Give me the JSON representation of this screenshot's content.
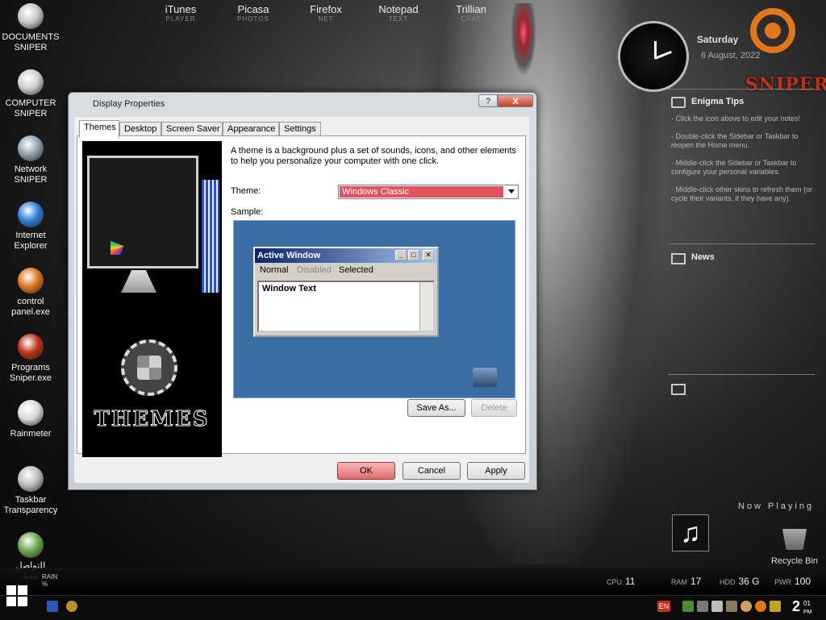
{
  "desktop_icons": [
    {
      "label": "DOCUMENTS\nSNIPER",
      "icon": "atom-icon",
      "color": "#c8c8c8"
    },
    {
      "label": "COMPUTER\nSNIPER",
      "icon": "computer-icon",
      "color": "#cfcfcf"
    },
    {
      "label": "Network\nSNIPER",
      "icon": "network-icon",
      "color": "#8fa3b0"
    },
    {
      "label": "Internet\nExplorer",
      "icon": "ie-icon",
      "color": "#2f7fd8"
    },
    {
      "label": "control\npanel.exe",
      "icon": "ubuntu-icon",
      "color": "#e2761b"
    },
    {
      "label": "Programs\nSniper.exe",
      "icon": "programs-icon",
      "color": "#c0301b"
    },
    {
      "label": "Rainmeter",
      "icon": "rainmeter-icon",
      "color": "#d9d9d9"
    },
    {
      "label": "Taskbar\nTransparency",
      "icon": "taskbar-icon",
      "color": "#bdbdbd"
    },
    {
      "label": "للتواصل\nمعنا",
      "icon": "globe-icon",
      "color": "#6aa84f"
    }
  ],
  "clock": {
    "day": "Saturday",
    "date": "6 August, 2022"
  },
  "brand": {
    "logo_text": "SNIPER"
  },
  "sidebar": {
    "tips_title": "Enigma Tips",
    "tips": [
      "· Click the icon above to edit your notes!",
      "· Double-click the Sidebar or Taskbar to reopen the Home menu.",
      "· Middle-click the Sidebar or Taskbar to configure your personal variables.",
      "· Middle-click other skins to refresh them (or cycle their variants, if they have any)."
    ],
    "news_title": "News",
    "now_playing": "Now Playing",
    "recycle_bin": "Recycle Bin"
  },
  "dialog": {
    "title": "Display Properties",
    "help_btn": "?",
    "close_btn": "X",
    "tabs": [
      "Themes",
      "Desktop",
      "Screen Saver",
      "Appearance",
      "Settings"
    ],
    "active_tab": "Themes",
    "description": "A theme is a background plus a set of sounds, icons, and other elements to help you personalize your computer with one click.",
    "theme_label": "Theme:",
    "theme_value": "Windows Classic",
    "sample_label": "Sample:",
    "art_text": "THEMES",
    "sample_window": {
      "title": "Active Window",
      "menu_normal": "Normal",
      "menu_disabled": "Disabled",
      "menu_selected": "Selected",
      "body_text": "Window Text"
    },
    "buttons": {
      "save_as": "Save As...",
      "delete": "Delete",
      "ok": "OK",
      "cancel": "Cancel",
      "apply": "Apply"
    }
  },
  "dock": {
    "apps": [
      {
        "name": "iTunes",
        "sub": "PLAYER"
      },
      {
        "name": "Picasa",
        "sub": "PHOTOS"
      },
      {
        "name": "Firefox",
        "sub": "NET"
      },
      {
        "name": "Notepad",
        "sub": "TEXT"
      },
      {
        "name": "Trillian",
        "sub": "CHAT"
      }
    ],
    "weather": {
      "label": "RAIN",
      "unit": "%"
    },
    "stats": [
      {
        "label": "CPU",
        "value": "11"
      },
      {
        "label": "RAM",
        "value": "17"
      },
      {
        "label": "HDD",
        "value": "36 G"
      },
      {
        "label": "PWR",
        "value": "100"
      }
    ]
  },
  "taskbar": {
    "language": "EN",
    "time_hour": "2",
    "time_min": "01",
    "time_ampm": "PM"
  },
  "colors": {
    "accent_red": "#e2525c",
    "ubuntu_orange": "#e2761b",
    "sample_bg": "#3a6ea5"
  }
}
